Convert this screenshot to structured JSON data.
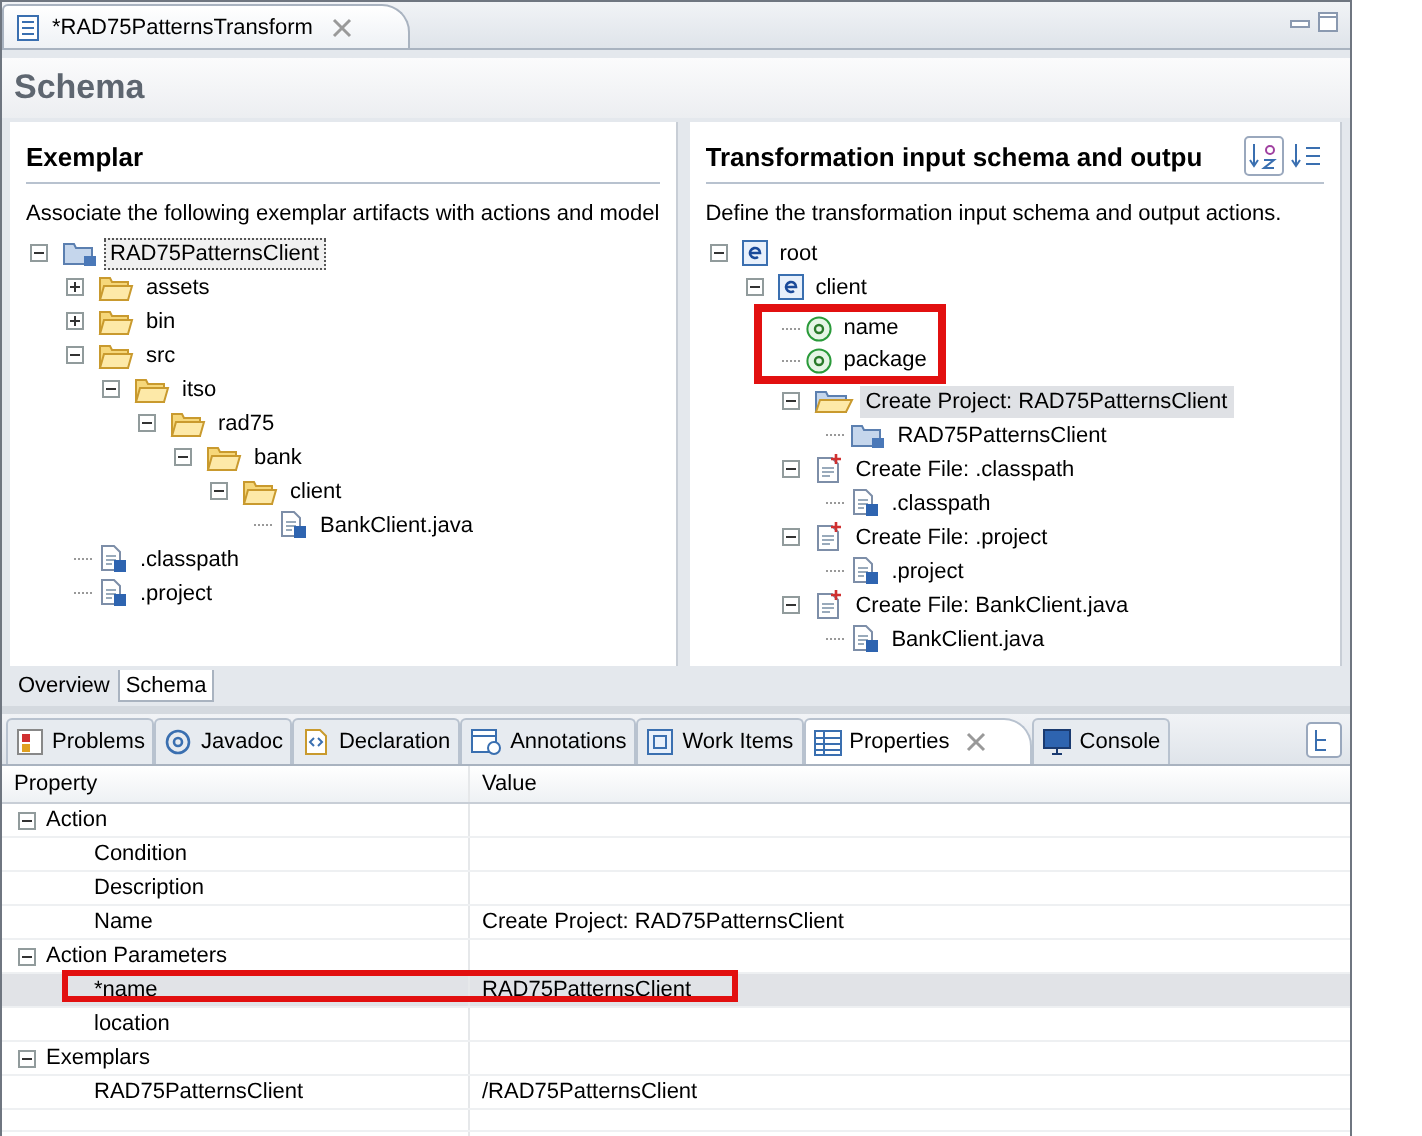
{
  "editor_tab": {
    "title": "*RAD75PatternsTransform",
    "selected": true
  },
  "page_title": "Schema",
  "exemplar": {
    "title": "Exemplar",
    "description": "Associate the following exemplar artifacts with actions and model",
    "tree": [
      {
        "label": "RAD75PatternsClient",
        "kind": "project",
        "expanded": true,
        "selected": true,
        "children": [
          {
            "label": "assets",
            "kind": "folder",
            "expanded": false,
            "selected": false
          },
          {
            "label": "bin",
            "kind": "folder",
            "expanded": false,
            "selected": false
          },
          {
            "label": "src",
            "kind": "folder",
            "expanded": true,
            "selected": false,
            "children": [
              {
                "label": "itso",
                "kind": "folder",
                "expanded": true,
                "selected": false,
                "children": [
                  {
                    "label": "rad75",
                    "kind": "folder",
                    "expanded": true,
                    "selected": false,
                    "children": [
                      {
                        "label": "bank",
                        "kind": "folder",
                        "expanded": true,
                        "selected": false,
                        "children": [
                          {
                            "label": "client",
                            "kind": "folder",
                            "expanded": true,
                            "selected": false,
                            "children": [
                              {
                                "label": "BankClient.java",
                                "kind": "file",
                                "selected": false
                              }
                            ]
                          }
                        ]
                      }
                    ]
                  }
                ]
              }
            ]
          },
          {
            "label": ".classpath",
            "kind": "file",
            "selected": false
          },
          {
            "label": ".project",
            "kind": "file",
            "selected": false
          }
        ]
      }
    ]
  },
  "transformation": {
    "title": "Transformation input schema and outpu",
    "description": "Define the transformation input schema and output actions.",
    "tree": [
      {
        "label": "root",
        "kind": "element",
        "expanded": true,
        "selected": false,
        "highlighted": false,
        "children": [
          {
            "label": "client",
            "kind": "element",
            "expanded": true,
            "selected": false,
            "highlighted": false,
            "children": [
              {
                "label": "name",
                "kind": "attribute",
                "selected": false,
                "highlighted": true
              },
              {
                "label": "package",
                "kind": "attribute",
                "selected": false,
                "highlighted": true
              },
              {
                "label": "Create Project: RAD75PatternsClient",
                "kind": "create-project",
                "expanded": true,
                "selected": true,
                "highlighted": false,
                "children": [
                  {
                    "label": "RAD75PatternsClient",
                    "kind": "project-ref",
                    "selected": false,
                    "highlighted": false
                  }
                ]
              },
              {
                "label": "Create File: .classpath",
                "kind": "create-file",
                "expanded": true,
                "selected": false,
                "highlighted": false,
                "children": [
                  {
                    "label": ".classpath",
                    "kind": "file-ref",
                    "selected": false,
                    "highlighted": false
                  }
                ]
              },
              {
                "label": "Create File: .project",
                "kind": "create-file",
                "expanded": true,
                "selected": false,
                "highlighted": false,
                "children": [
                  {
                    "label": ".project",
                    "kind": "file-ref",
                    "selected": false,
                    "highlighted": false
                  }
                ]
              },
              {
                "label": "Create File: BankClient.java",
                "kind": "create-file",
                "expanded": true,
                "selected": false,
                "highlighted": false,
                "children": [
                  {
                    "label": "BankClient.java",
                    "kind": "file-ref",
                    "selected": false,
                    "highlighted": false
                  }
                ]
              }
            ]
          }
        ]
      }
    ]
  },
  "editor_pages": [
    {
      "label": "Overview",
      "selected": false
    },
    {
      "label": "Schema",
      "selected": true
    }
  ],
  "view_tabs": [
    {
      "label": "Problems",
      "kind": "problems",
      "selected": false
    },
    {
      "label": "Javadoc",
      "kind": "javadoc",
      "selected": false
    },
    {
      "label": "Declaration",
      "kind": "declaration",
      "selected": false
    },
    {
      "label": "Annotations",
      "kind": "annotations",
      "selected": false
    },
    {
      "label": "Work Items",
      "kind": "work-items",
      "selected": false
    },
    {
      "label": "Properties",
      "kind": "properties",
      "selected": true
    },
    {
      "label": "Console",
      "kind": "console",
      "selected": false
    }
  ],
  "properties": {
    "columns": [
      "Property",
      "Value"
    ],
    "rows": [
      {
        "kind": "category",
        "property": "Action",
        "expanded": true,
        "selected": false,
        "highlighted": false
      },
      {
        "kind": "property",
        "property": "Condition",
        "selected": false,
        "highlighted": false
      },
      {
        "kind": "property",
        "property": "Description",
        "selected": false,
        "highlighted": false
      },
      {
        "kind": "property",
        "property": "Name",
        "value": "Create Project: RAD75PatternsClient",
        "selected": false,
        "highlighted": false
      },
      {
        "kind": "category",
        "property": "Action Parameters",
        "expanded": true,
        "selected": false,
        "highlighted": false
      },
      {
        "kind": "property",
        "property": "*name",
        "value": "RAD75PatternsClient",
        "selected": true,
        "highlighted": true
      },
      {
        "kind": "property",
        "property": "location",
        "selected": false,
        "highlighted": false
      },
      {
        "kind": "category",
        "property": "Exemplars",
        "expanded": true,
        "selected": false,
        "highlighted": false
      },
      {
        "kind": "property",
        "property": "RAD75PatternsClient",
        "value": "/RAD75PatternsClient",
        "selected": false,
        "highlighted": false
      }
    ]
  }
}
